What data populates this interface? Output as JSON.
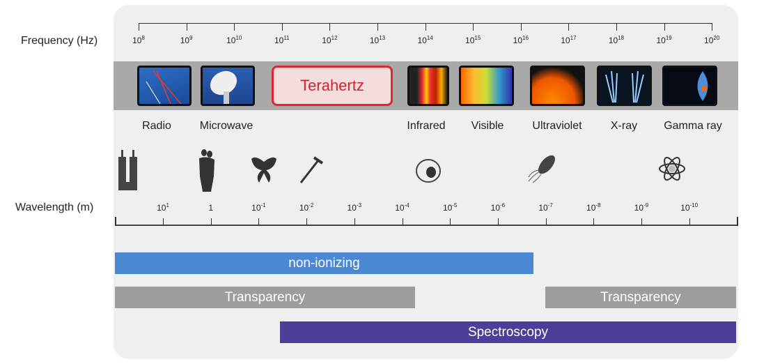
{
  "frequency_axis": {
    "label": "Frequency (Hz)",
    "ticks": [
      {
        "b": "10",
        "e": "8"
      },
      {
        "b": "10",
        "e": "9"
      },
      {
        "b": "10",
        "e": "10"
      },
      {
        "b": "10",
        "e": "11"
      },
      {
        "b": "10",
        "e": "12"
      },
      {
        "b": "10",
        "e": "13"
      },
      {
        "b": "10",
        "e": "14"
      },
      {
        "b": "10",
        "e": "15"
      },
      {
        "b": "10",
        "e": "16"
      },
      {
        "b": "10",
        "e": "17"
      },
      {
        "b": "10",
        "e": "18"
      },
      {
        "b": "10",
        "e": "19"
      },
      {
        "b": "10",
        "e": "20"
      }
    ]
  },
  "wavelength_axis": {
    "label": "Wavelength (m)",
    "ticks": [
      {
        "b": "10",
        "e": "1"
      },
      {
        "b": "1",
        "e": ""
      },
      {
        "b": "10",
        "e": "-1"
      },
      {
        "b": "10",
        "e": "-2"
      },
      {
        "b": "10",
        "e": "-3"
      },
      {
        "b": "10",
        "e": "-4"
      },
      {
        "b": "10",
        "e": "-5"
      },
      {
        "b": "10",
        "e": "-6"
      },
      {
        "b": "10",
        "e": "-7"
      },
      {
        "b": "10",
        "e": "-8"
      },
      {
        "b": "10",
        "e": "-9"
      },
      {
        "b": "10",
        "e": "-10"
      }
    ]
  },
  "terahertz_label": "Terahertz",
  "bands": [
    "Radio",
    "Microwave",
    "Infrared",
    "Visible",
    "Ultraviolet",
    "X-ray",
    "Gamma ray"
  ],
  "scale_objects": [
    "buildings-icon",
    "people-icon",
    "butterfly-icon",
    "needle-icon",
    "cell-icon",
    "bacteria-icon",
    "atom-icon"
  ],
  "bars": {
    "non_ionizing": "non-ionizing",
    "transparency": "Transparency",
    "spectroscopy": "Spectroscopy"
  },
  "colors": {
    "non_ionizing": "#4a88d2",
    "transparency": "#9d9d9d",
    "spectroscopy": "#4b3f99",
    "terahertz": "#e0262e"
  }
}
